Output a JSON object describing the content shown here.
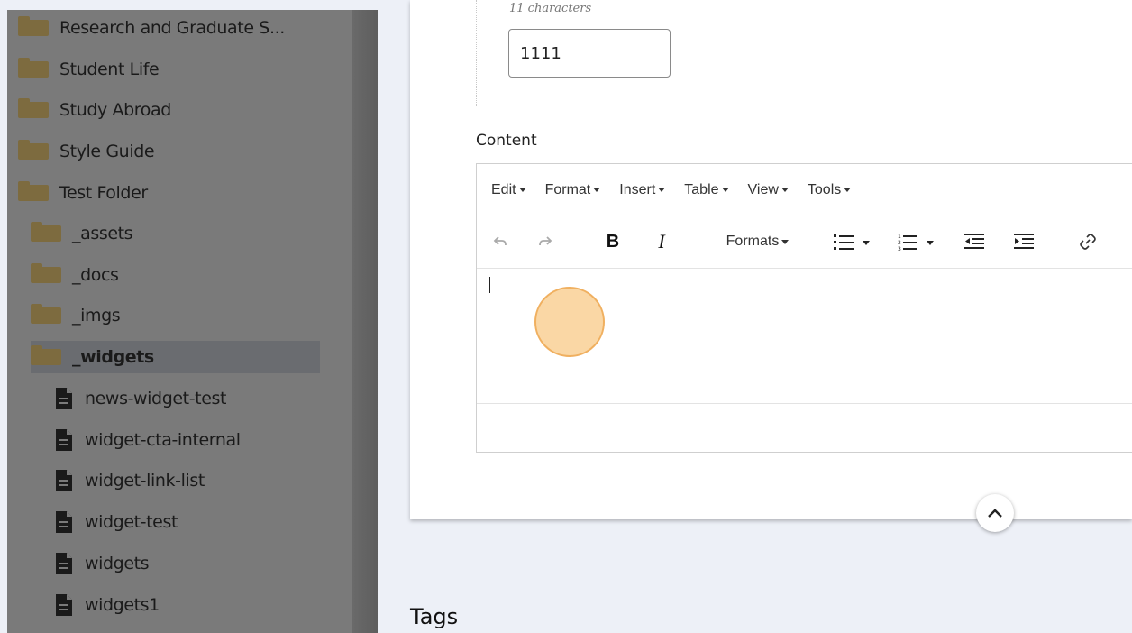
{
  "sidebar": {
    "folders": [
      {
        "label": "Research and Graduate S..."
      },
      {
        "label": "Student Life"
      },
      {
        "label": "Study Abroad"
      },
      {
        "label": "Style Guide"
      },
      {
        "label": "Test Folder"
      }
    ],
    "subfolders": [
      {
        "label": "_assets"
      },
      {
        "label": "_docs"
      },
      {
        "label": "_imgs"
      },
      {
        "label": "_widgets",
        "active": true
      }
    ],
    "files": [
      {
        "label": "news-widget-test"
      },
      {
        "label": "widget-cta-internal"
      },
      {
        "label": "widget-link-list"
      },
      {
        "label": "widget-test"
      },
      {
        "label": "widgets"
      },
      {
        "label": "widgets1"
      }
    ]
  },
  "form": {
    "char_hint": "11 characters",
    "number_value": "1111",
    "content_label": "Content"
  },
  "editor": {
    "menus": [
      "Edit",
      "Format",
      "Insert",
      "Table",
      "View",
      "Tools"
    ],
    "toolbar": {
      "undo_icon": "undo-icon",
      "redo_icon": "redo-icon",
      "bold_label": "B",
      "italic_label": "I",
      "formats_label": "Formats",
      "bullet_list_icon": "bullet-list-icon",
      "numbered_list_icon": "numbered-list-icon",
      "outdent_icon": "outdent-icon",
      "indent_icon": "indent-icon",
      "link_icon": "link-icon"
    },
    "body_text": ""
  },
  "tags": {
    "heading": "Tags"
  },
  "colors": {
    "sidebar_overlay": "#7a7a7a",
    "folder": "#7d6b3f",
    "click_marker_fill": "#fad7a5",
    "click_marker_border": "#f0b060"
  }
}
